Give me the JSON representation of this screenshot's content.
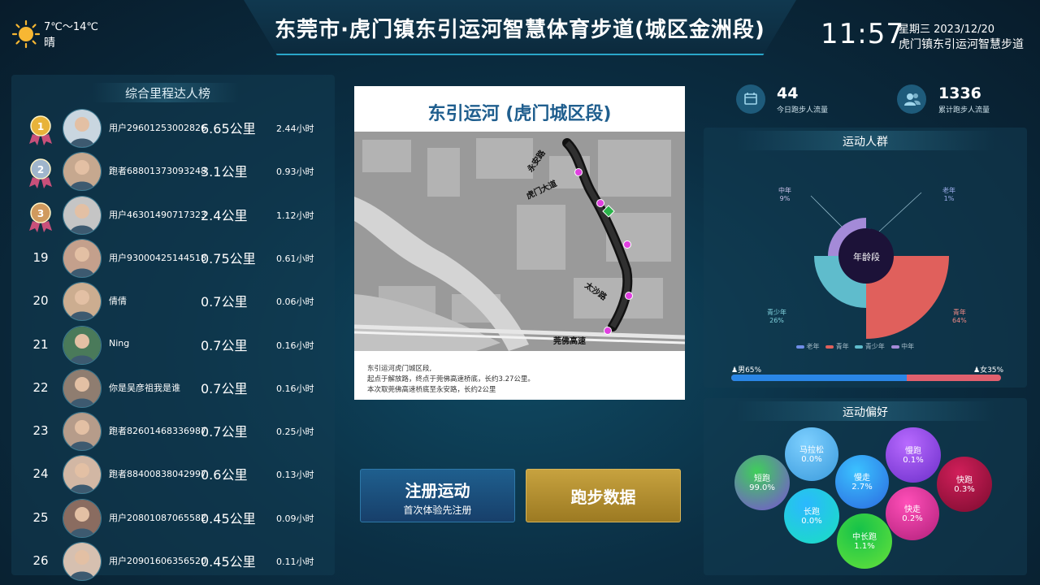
{
  "weather": {
    "temp": "7℃～14℃",
    "condition": "晴"
  },
  "title": "东莞市·虎门镇东引运河智慧体育步道(城区金洲段)",
  "clock": {
    "time": "11:57",
    "date": "星期三  2023/12/20",
    "place": "虎门镇东引运河智慧步道"
  },
  "leaderboard": {
    "title": "综合里程达人榜",
    "rows": [
      {
        "rank": "",
        "medal": "1",
        "name": "用户29601253002826",
        "distance": "6.65公里",
        "hours": "2.44小时"
      },
      {
        "rank": "",
        "medal": "2",
        "name": "跑者68801373093248",
        "distance": "3.1公里",
        "hours": "0.93小时"
      },
      {
        "rank": "",
        "medal": "3",
        "name": "用户46301490717323",
        "distance": "2.4公里",
        "hours": "1.12小时"
      },
      {
        "rank": "19",
        "medal": "",
        "name": "用户93000425144518",
        "distance": "0.75公里",
        "hours": "0.61小时"
      },
      {
        "rank": "20",
        "medal": "",
        "name": "倩倩",
        "distance": "0.7公里",
        "hours": "0.06小时"
      },
      {
        "rank": "21",
        "medal": "",
        "name": "Ning",
        "distance": "0.7公里",
        "hours": "0.16小时"
      },
      {
        "rank": "22",
        "medal": "",
        "name": "你是吴彦祖我是谁",
        "distance": "0.7公里",
        "hours": "0.16小时"
      },
      {
        "rank": "23",
        "medal": "",
        "name": "跑者82601468336987",
        "distance": "0.7公里",
        "hours": "0.25小时"
      },
      {
        "rank": "24",
        "medal": "",
        "name": "跑者88400838042997",
        "distance": "0.6公里",
        "hours": "0.13小时"
      },
      {
        "rank": "25",
        "medal": "",
        "name": "用户20801087065582",
        "distance": "0.45公里",
        "hours": "0.09小时"
      },
      {
        "rank": "26",
        "medal": "",
        "name": "用户20901606356520",
        "distance": "0.45公里",
        "hours": "0.11小时"
      }
    ]
  },
  "map": {
    "title": "东引运河 (虎门城区段)",
    "labels": [
      "永安路",
      "虎门大道",
      "太沙路",
      "莞佛高速"
    ],
    "desc": [
      "东引运河虎门城区段,",
      "起点于解放路，终点于莞佛高速桥底，长约3.27公里。",
      "本次取莞佛高速桥底至永安路，长约2公里"
    ]
  },
  "buttons": {
    "register_main": "注册运动",
    "register_sub": "首次体验先注册",
    "run_data": "跑步数据"
  },
  "stats": {
    "today": {
      "value": "44",
      "label": "今日跑步人流量"
    },
    "total": {
      "value": "1336",
      "label": "累计跑步人流量"
    }
  },
  "crowd": {
    "title": "运动人群",
    "center": "年龄段",
    "segments": [
      {
        "name": "老年",
        "pct": "1%",
        "color": "#6f8de8"
      },
      {
        "name": "青年",
        "pct": "64%",
        "color": "#e0605c"
      },
      {
        "name": "青少年",
        "pct": "26%",
        "color": "#5fbccc"
      },
      {
        "name": "中年",
        "pct": "9%",
        "color": "#a48ad8"
      }
    ],
    "gender": {
      "male": "男65%",
      "female": "女35%",
      "male_frac": 0.65
    }
  },
  "preference": {
    "title": "运动偏好",
    "items": [
      {
        "name": "马拉松",
        "pct": "0.0%"
      },
      {
        "name": "慢跑",
        "pct": "0.1%"
      },
      {
        "name": "短跑",
        "pct": "99.0%"
      },
      {
        "name": "慢走",
        "pct": "2.7%"
      },
      {
        "name": "快跑",
        "pct": "0.3%"
      },
      {
        "name": "长跑",
        "pct": "0.0%"
      },
      {
        "name": "快走",
        "pct": "0.2%"
      },
      {
        "name": "中长跑",
        "pct": "1.1%"
      }
    ]
  }
}
